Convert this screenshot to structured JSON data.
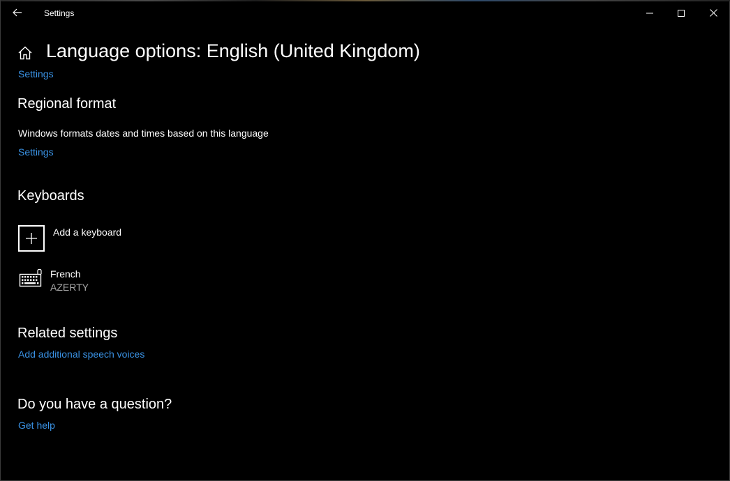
{
  "window": {
    "title": "Settings"
  },
  "page": {
    "title": "Language options: English (United Kingdom)",
    "settings_link": "Settings"
  },
  "regional_format": {
    "heading": "Regional format",
    "description": "Windows formats dates and times based on this language",
    "settings_link": "Settings"
  },
  "keyboards": {
    "heading": "Keyboards",
    "add_label": "Add a keyboard",
    "items": [
      {
        "name": "French",
        "layout": "AZERTY"
      }
    ]
  },
  "related": {
    "heading": "Related settings",
    "link": "Add additional speech voices"
  },
  "question": {
    "heading": "Do you have a question?",
    "link": "Get help"
  },
  "icons": {
    "back": "back-arrow-icon",
    "home": "home-icon",
    "minimize": "minimize-icon",
    "maximize": "maximize-icon",
    "close": "close-icon",
    "add": "plus-icon",
    "keyboard": "keyboard-icon"
  },
  "colors": {
    "background": "#000000",
    "accent_link": "#3a93e6",
    "text": "#ffffff",
    "secondary_text": "#a6a6a6"
  }
}
